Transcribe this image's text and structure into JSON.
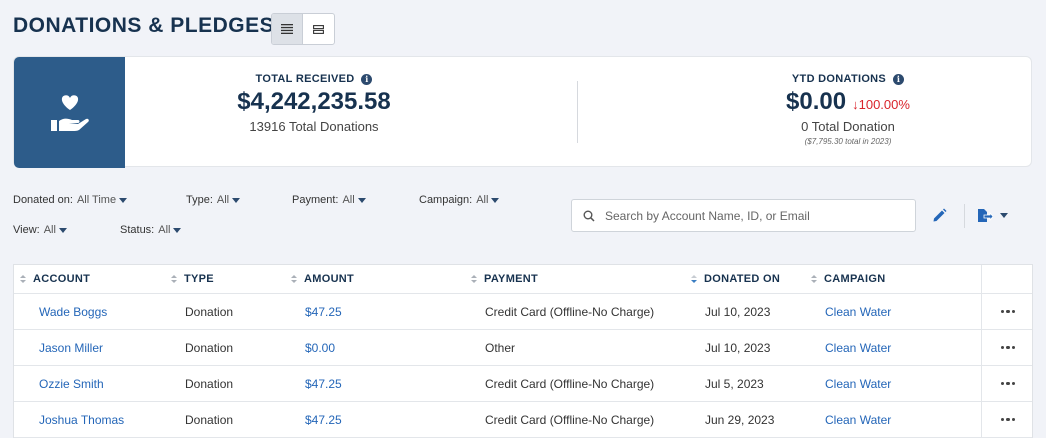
{
  "page": {
    "title": "DONATIONS & PLEDGES"
  },
  "summary": {
    "total_received": {
      "label": "TOTAL RECEIVED",
      "value": "$4,242,235.58",
      "sub": "13916 Total Donations"
    },
    "ytd": {
      "label": "YTD DONATIONS",
      "value": "$0.00",
      "change": "↓100.00%",
      "sub": "0 Total Donation",
      "note": "($7,795.30 total in 2023)"
    }
  },
  "filters": {
    "donated_on": {
      "label": "Donated on:",
      "value": "All Time"
    },
    "type": {
      "label": "Type:",
      "value": "All"
    },
    "payment": {
      "label": "Payment:",
      "value": "All"
    },
    "campaign": {
      "label": "Campaign:",
      "value": "All"
    },
    "view": {
      "label": "View:",
      "value": "All"
    },
    "status": {
      "label": "Status:",
      "value": "All"
    }
  },
  "search": {
    "placeholder": "Search by Account Name, ID, or Email",
    "value": ""
  },
  "table": {
    "columns": [
      "ACCOUNT",
      "TYPE",
      "AMOUNT",
      "PAYMENT",
      "DONATED ON",
      "CAMPAIGN"
    ],
    "rows": [
      {
        "account": "Wade Boggs",
        "type": "Donation",
        "amount": "$47.25",
        "payment": "Credit Card (Offline-No Charge)",
        "donated_on": "Jul 10, 2023",
        "campaign": "Clean Water"
      },
      {
        "account": "Jason Miller",
        "type": "Donation",
        "amount": "$0.00",
        "payment": "Other",
        "donated_on": "Jul 10, 2023",
        "campaign": "Clean Water"
      },
      {
        "account": "Ozzie Smith",
        "type": "Donation",
        "amount": "$47.25",
        "payment": "Credit Card (Offline-No Charge)",
        "donated_on": "Jul 5, 2023",
        "campaign": "Clean Water"
      },
      {
        "account": "Joshua Thomas",
        "type": "Donation",
        "amount": "$47.25",
        "payment": "Credit Card (Offline-No Charge)",
        "donated_on": "Jun 29, 2023",
        "campaign": "Clean Water"
      }
    ]
  },
  "colors": {
    "navy": "#17324f",
    "tile": "#2d5c8a",
    "link": "#2466b8",
    "negative": "#d9242b"
  },
  "icons": [
    "list-view-icon",
    "compact-view-icon",
    "hand-heart-icon",
    "info-icon",
    "search-icon",
    "pencil-icon",
    "export-icon",
    "more-icon"
  ]
}
